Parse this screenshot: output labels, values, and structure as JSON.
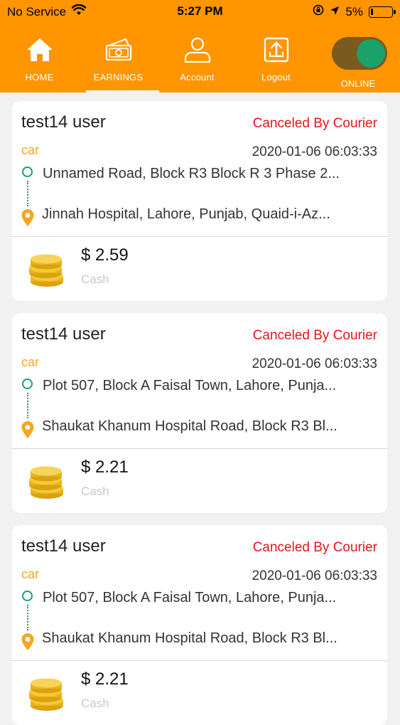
{
  "status_bar": {
    "carrier": "No Service",
    "time": "5:27 PM",
    "battery": "5%"
  },
  "nav": {
    "items": [
      {
        "label": "HOME",
        "icon": "home-icon"
      },
      {
        "label": "EARNINGS",
        "icon": "money-icon"
      },
      {
        "label": "Account",
        "icon": "user-icon"
      },
      {
        "label": "Logout",
        "icon": "logout-icon"
      }
    ],
    "active": "EARNINGS",
    "online_label": "ONLINE",
    "online": true
  },
  "colors": {
    "brand": "#ff9500",
    "status": "#e8141c",
    "vehicle": "#f5a623",
    "route": "#1aa26a"
  },
  "trips": [
    {
      "name": "test14 user",
      "status": "Canceled By Courier",
      "vehicle": "car",
      "datetime": "2020-01-06 06:03:33",
      "pickup": "Unnamed Road, Block R3 Block R 3 Phase 2...",
      "dropoff": "Jinnah Hospital, Lahore, Punjab, Quaid-i-Az...",
      "amount": "$ 2.59",
      "payment": "Cash"
    },
    {
      "name": "test14 user",
      "status": "Canceled By Courier",
      "vehicle": "car",
      "datetime": "2020-01-06 06:03:33",
      "pickup": "Plot 507, Block A Faisal Town, Lahore, Punja...",
      "dropoff": "Shaukat Khanum Hospital Road, Block R3 Bl...",
      "amount": "$ 2.21",
      "payment": "Cash"
    },
    {
      "name": "test14 user",
      "status": "Canceled By Courier",
      "vehicle": "car",
      "datetime": "2020-01-06 06:03:33",
      "pickup": "Plot 507, Block A Faisal Town, Lahore, Punja...",
      "dropoff": "Shaukat Khanum Hospital Road, Block R3 Bl...",
      "amount": "$ 2.21",
      "payment": "Cash"
    }
  ]
}
